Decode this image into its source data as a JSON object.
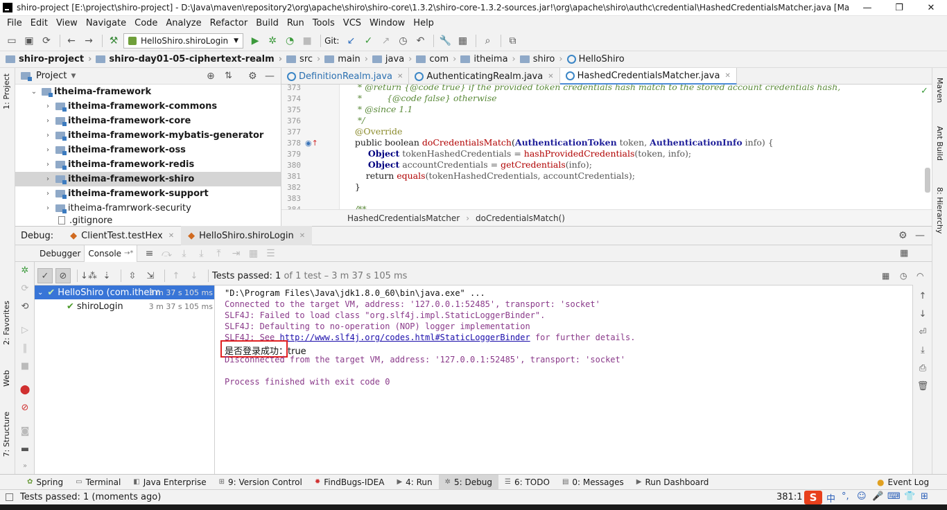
{
  "window": {
    "title": "shiro-project [E:\\project\\shiro-project] - D:\\Java\\maven\\repository2\\org\\apache\\shiro\\shiro-core\\1.3.2\\shiro-core-1.3.2-sources.jar!\\org\\apache\\shiro\\authc\\credential\\HashedCredentialsMatcher.java [Mav..."
  },
  "menu": [
    "File",
    "Edit",
    "View",
    "Navigate",
    "Code",
    "Analyze",
    "Refactor",
    "Build",
    "Run",
    "Tools",
    "VCS",
    "Window",
    "Help"
  ],
  "toolbar": {
    "run_config": "HelloShiro.shiroLogin",
    "git_label": "Git:"
  },
  "breadcrumb": [
    "shiro-project",
    "shiro-day01-05-ciphertext-realm",
    "src",
    "main",
    "java",
    "com",
    "itheima",
    "shiro",
    "HelloShiro"
  ],
  "left_tabs": [
    "1: Project",
    "2: Favorites",
    "Web",
    "7: Structure"
  ],
  "right_tabs": [
    "Maven",
    "Ant Build",
    "8: Hierarchy"
  ],
  "project": {
    "title": "Project",
    "root": "itheima-framework",
    "items": [
      {
        "label": "itheima-framework-commons",
        "bold": true
      },
      {
        "label": "itheima-framework-core",
        "bold": true
      },
      {
        "label": "itheima-framework-mybatis-generator",
        "bold": true
      },
      {
        "label": "itheima-framework-oss",
        "bold": true
      },
      {
        "label": "itheima-framework-redis",
        "bold": true
      },
      {
        "label": "itheima-framework-shiro",
        "bold": true
      },
      {
        "label": "itheima-framework-support",
        "bold": true
      },
      {
        "label": "itheima-framrwork-security",
        "bold": false
      }
    ],
    "last_item": ".gitignore"
  },
  "editor": {
    "tabs": [
      "DefinitionRealm.java",
      "AuthenticatingRealm.java",
      "HashedCredentialsMatcher.java"
    ],
    "line_numbers": [
      "373",
      "374",
      "375",
      "376",
      "377",
      "378",
      "379",
      "380",
      "381",
      "382",
      "383",
      "384"
    ],
    "code": {
      "l373": "     * @return {@code true} if the provided token credentials hash match to the stored account credentials hash,",
      "l374": "     *         {@code false} otherwise",
      "l375": "     * @since 1.1",
      "l376": "     */",
      "l377": "    @Override",
      "l378_a": "    public boolean ",
      "l378_b": "doCredentialsMatch",
      "l378_c": "(",
      "l378_d": "AuthenticationToken",
      "l378_e": " token, ",
      "l378_f": "AuthenticationInfo",
      "l378_g": " info) {",
      "l379_a": "        Object",
      "l379_b": " tokenHashedCredentials = ",
      "l379_c": "hashProvidedCredentials",
      "l379_d": "(token, info);",
      "l380_a": "        Object",
      "l380_b": " accountCredentials = ",
      "l380_c": "getCredentials",
      "l380_d": "(info);",
      "l381_a": "        return ",
      "l381_b": "equals",
      "l381_c": "(tokenHashedCredentials, accountCredentials);",
      "l382": "    }",
      "l384": "    /**"
    },
    "breadcrumb": [
      "HashedCredentialsMatcher",
      "doCredentialsMatch()"
    ]
  },
  "debug": {
    "label": "Debug:",
    "tabs": [
      "ClientTest.testHex",
      "HelloShiro.shiroLogin"
    ],
    "subtabs": [
      "Debugger",
      "Console"
    ],
    "tests_passed_label": "Tests passed:",
    "tests_passed_count": "1",
    "tests_passed_detail": "of 1 test – 3 m 37 s 105 ms",
    "tree": [
      {
        "label": "HelloShiro (com.itheim",
        "time": "3 m 37 s 105 ms"
      },
      {
        "label": "shiroLogin",
        "time": "3 m 37 s 105 ms"
      }
    ],
    "console": {
      "l1": "\"D:\\Program Files\\Java\\jdk1.8.0_60\\bin\\java.exe\" ...",
      "l2": "Connected to the target VM, address: '127.0.0.1:52485', transport: 'socket'",
      "l3": "SLF4J: Failed to load class \"org.slf4j.impl.StaticLoggerBinder\".",
      "l4": "SLF4J: Defaulting to no-operation (NOP) logger implementation",
      "l5_a": "SLF4J: See ",
      "l5_b": "http://www.slf4j.org/codes.html#StaticLoggerBinder",
      "l5_c": " for further details.",
      "l6": "是否登录成功：true",
      "l7": "Disconnected from the target VM, address: '127.0.0.1:52485', transport: 'socket'",
      "l8": "Process finished with exit code 0"
    }
  },
  "bottom_tabs": [
    "Spring",
    "Terminal",
    "Java Enterprise",
    "9: Version Control",
    "FindBugs-IDEA",
    "4: Run",
    "5: Debug",
    "6: TODO",
    "0: Messages",
    "Run Dashboard"
  ],
  "event_log": "Event Log",
  "status": {
    "message": "Tests passed: 1 (moments ago)",
    "position": "381:1"
  },
  "ime": [
    "中",
    "°,",
    "☺",
    "🎤",
    "⌨",
    "👕",
    "⊞"
  ],
  "colors": {
    "accent": "#3875d7",
    "highlight_border": "#e02020",
    "console_magenta": "#8a3a8a"
  }
}
